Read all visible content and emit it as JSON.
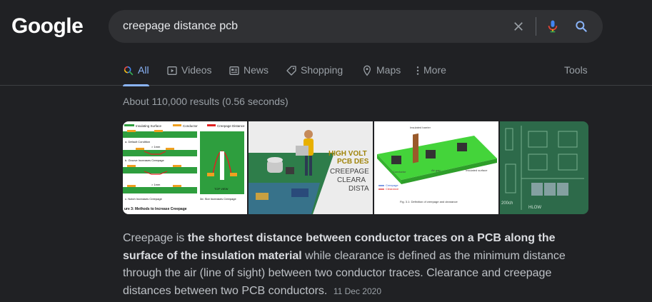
{
  "logo": "Google",
  "search": {
    "query": "creepage distance pcb"
  },
  "tabs": [
    {
      "label": "All",
      "icon": "search-icon",
      "active": true
    },
    {
      "label": "Videos",
      "icon": "play-icon"
    },
    {
      "label": "News",
      "icon": "news-icon"
    },
    {
      "label": "Shopping",
      "icon": "tag-icon"
    },
    {
      "label": "Maps",
      "icon": "map-pin-icon"
    },
    {
      "label": "More",
      "icon": "more-vert-icon"
    }
  ],
  "tools_label": "Tools",
  "result_stats": "About 110,000 results (0.56 seconds)",
  "images": [
    {
      "texts": {
        "insulating": "Insulating Surface",
        "conductor": "Conductor",
        "creepage_distance": "Creepage Distance",
        "default": "a. Default Condition",
        "groove": "b. Groove Increases Creepage",
        "notch": "c. Notch Increases Creepage",
        "slot": "3d. Slot Increases Creepage",
        "caption": "ure 3: Methods to Increase Creepage",
        "mm1": "> 1mm",
        "mm2": "> 1mm",
        "top_view": "TOP VIEW"
      }
    },
    {
      "texts": {
        "line1": "HIGH VOLT",
        "line2": "PCB DES",
        "line3": "CREEPAGE",
        "line4": "CLEARA",
        "line5": "DISTA"
      }
    },
    {
      "texts": {
        "insulated_barrier": "Insulated barrier",
        "conductor": "Conductor",
        "air_gap": "Air gap",
        "insulated_surface": "Insulated surface",
        "legend_creepage": "Creepage",
        "legend_clearance": "Clearance",
        "caption": "Fig. 3.1: Definition of creepage and clearance"
      }
    },
    {
      "texts": {
        "label1": "HLOW",
        "label2": "200ch"
      }
    }
  ],
  "snippet": {
    "prefix": "Creepage is ",
    "bold": "the shortest distance between conductor traces on a PCB along the surface of the insulation material",
    "suffix": " while clearance is defined as the minimum distance through the air (line of sight) between two conductor traces. Clearance and creepage distances between two PCB conductors.",
    "date": "11 Dec 2020"
  },
  "colors": {
    "background": "#202124",
    "accent": "#8ab4f8",
    "text": "#bdc1c6"
  }
}
